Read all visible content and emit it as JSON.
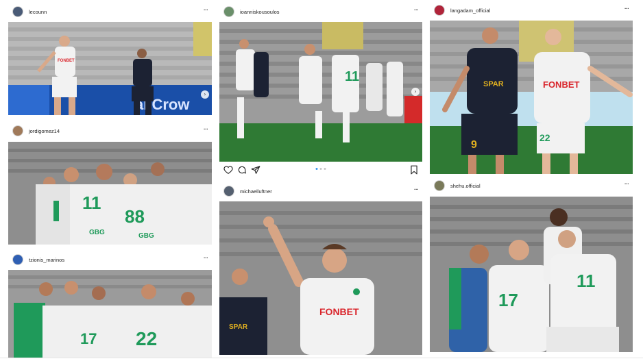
{
  "column_left": {
    "posts": [
      {
        "username": "lecounn",
        "more": "···"
      },
      {
        "username": "jordigomez14",
        "more": "···"
      },
      {
        "username": "tzionis_marinos",
        "more": "···"
      }
    ]
  },
  "column_middle": {
    "posts": [
      {
        "username": "ioanniskousoulos",
        "more": "···",
        "carousel": {
          "dots": 3,
          "active": 0
        }
      },
      {
        "username": "michaelluftner",
        "more": "···"
      }
    ]
  },
  "column_right": {
    "posts": [
      {
        "username": "langadam_official",
        "more": "···"
      },
      {
        "username": "shehu.official",
        "more": "···"
      }
    ]
  },
  "photo_text": {
    "banner": "al Crow",
    "sponsor_fonbet": "FONBET",
    "sponsor_gbg": "GBG",
    "sponsor_sparta": "SPAR",
    "number_11": "11",
    "number_17": "17",
    "number_22": "22",
    "number_88": "88",
    "number_9": "9"
  },
  "colors": {
    "pitch": "#2f7a34",
    "kit_white": "#f2f2f2",
    "kit_dark": "#1c2233",
    "kit_green": "#1f9a5a",
    "sponsor_red": "#d9242b",
    "stands": "#9a9a9a",
    "banner_blue": "#1a4fa8"
  }
}
